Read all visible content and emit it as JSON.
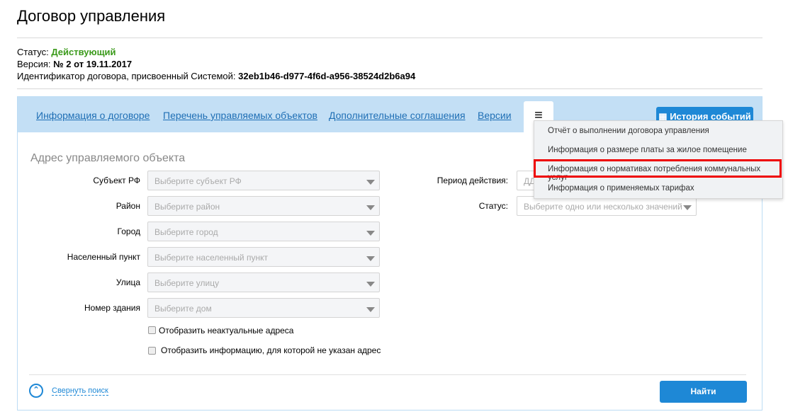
{
  "title": "Договор управления",
  "meta": {
    "status_label": "Статус:",
    "status_value": "Действующий",
    "version_label": "Версия:",
    "version_value": "№ 2 от 19.11.2017",
    "id_label": "Идентификатор договора, присвоенный Системой:",
    "id_value": "32eb1b46-d977-4f6d-a956-38524d2b6a94"
  },
  "tabs": [
    "Информация о договоре",
    "Перечень управляемых объектов",
    "Дополнительные соглашения",
    "Версии"
  ],
  "history_button": "История событий",
  "menu": [
    "Отчёт о выполнении договора управления",
    "Информация о размере платы за жилое помещение",
    "Информация о нормативах потребления коммунальных услуг",
    "Информация о применяемых тарифах"
  ],
  "section_title": "Адрес управляемого объекта",
  "fields": [
    {
      "label": "Субъект РФ",
      "placeholder": "Выберите субъект РФ"
    },
    {
      "label": "Район",
      "placeholder": "Выберите район"
    },
    {
      "label": "Город",
      "placeholder": "Выберите город"
    },
    {
      "label": "Населенный пункт",
      "placeholder": "Выберите населенный пункт"
    },
    {
      "label": "Улица",
      "placeholder": "Выберите улицу"
    },
    {
      "label": "Номер здания",
      "placeholder": "Выберите дом"
    }
  ],
  "period": {
    "label": "Период действия:",
    "placeholder": "ДД."
  },
  "status_field": {
    "label": "Статус:",
    "placeholder": "Выберите одно или несколько значений"
  },
  "checkboxes": [
    "Отобразить неактуальные адреса",
    "Отобразить информацию, для которой не указан адрес"
  ],
  "collapse_link": "Свернуть поиск",
  "find_button": "Найти",
  "colors": {
    "accent": "#1e88d6",
    "status": "#3a9a1a",
    "highlight": "#e00000"
  }
}
